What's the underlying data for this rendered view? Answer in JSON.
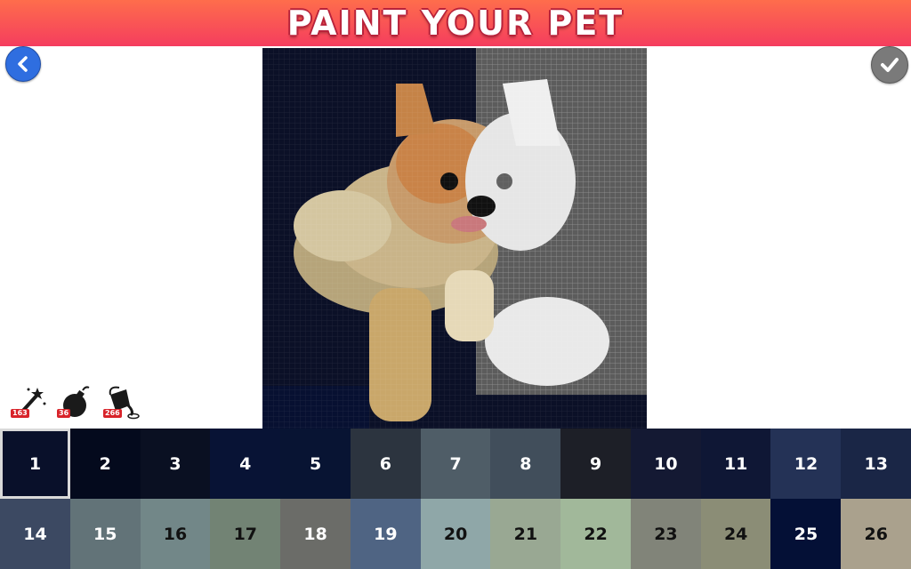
{
  "header": {
    "title": "PAINT YOUR PET"
  },
  "colors": {
    "header_top": "#fe6d4c",
    "header_bottom": "#f53d5e",
    "back_button": "#2f6ee0",
    "confirm_button": "#7a7a7a"
  },
  "tools": [
    {
      "name": "magic-wand",
      "icon": "magic-wand-icon",
      "count": "163"
    },
    {
      "name": "bomb",
      "icon": "bomb-icon",
      "count": "36"
    },
    {
      "name": "paint-bucket",
      "icon": "paint-bucket-icon",
      "count": "266"
    }
  ],
  "palette": {
    "selected": "1",
    "swatches": [
      {
        "label": "1",
        "color": "#09102a",
        "text": "#ffffff"
      },
      {
        "label": "2",
        "color": "#040a1d",
        "text": "#ffffff"
      },
      {
        "label": "3",
        "color": "#0a1022",
        "text": "#ffffff"
      },
      {
        "label": "4",
        "color": "#081335",
        "text": "#ffffff"
      },
      {
        "label": "5",
        "color": "#081433",
        "text": "#ffffff"
      },
      {
        "label": "6",
        "color": "#2c343f",
        "text": "#ffffff"
      },
      {
        "label": "7",
        "color": "#4f5d67",
        "text": "#ffffff"
      },
      {
        "label": "8",
        "color": "#414e5b",
        "text": "#ffffff"
      },
      {
        "label": "9",
        "color": "#1d1f27",
        "text": "#ffffff"
      },
      {
        "label": "10",
        "color": "#141933",
        "text": "#ffffff"
      },
      {
        "label": "11",
        "color": "#0f1735",
        "text": "#ffffff"
      },
      {
        "label": "12",
        "color": "#243256",
        "text": "#ffffff"
      },
      {
        "label": "13",
        "color": "#1a2646",
        "text": "#ffffff"
      },
      {
        "label": "14",
        "color": "#3c4962",
        "text": "#ffffff"
      },
      {
        "label": "15",
        "color": "#627378",
        "text": "#ffffff"
      },
      {
        "label": "16",
        "color": "#728788",
        "text": "#111111"
      },
      {
        "label": "17",
        "color": "#728374",
        "text": "#111111"
      },
      {
        "label": "18",
        "color": "#6b6c68",
        "text": "#ffffff"
      },
      {
        "label": "19",
        "color": "#4f6483",
        "text": "#ffffff"
      },
      {
        "label": "20",
        "color": "#8fa7a8",
        "text": "#111111"
      },
      {
        "label": "21",
        "color": "#99a893",
        "text": "#111111"
      },
      {
        "label": "22",
        "color": "#a1b89a",
        "text": "#111111"
      },
      {
        "label": "23",
        "color": "#818479",
        "text": "#111111"
      },
      {
        "label": "24",
        "color": "#8b8d76",
        "text": "#111111"
      },
      {
        "label": "25",
        "color": "#041036",
        "text": "#ffffff"
      },
      {
        "label": "26",
        "color": "#aaa18d",
        "text": "#111111"
      }
    ]
  }
}
